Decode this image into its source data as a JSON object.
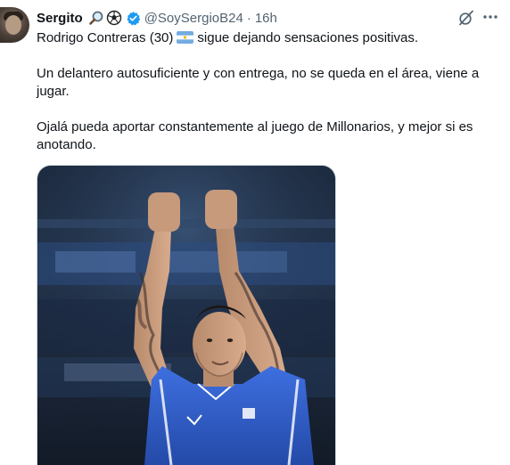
{
  "author": {
    "name": "Sergito",
    "handle": "@SoySergioB24",
    "separator": "·",
    "time": "16h",
    "name_emojis": [
      "magnifying-glass-icon",
      "soccer-ball-icon"
    ],
    "verified": true
  },
  "tweet": {
    "p1_before": "Rodrigo Contreras (30)",
    "p1_flag": "argentina-flag-icon",
    "p1_after": "sigue dejando sensaciones positivas.",
    "p2": "Un delantero autosuficiente y con entrega, no se queda en el área, viene a jugar.",
    "p3": "Ojalá pueda aportar constantemente al juego de Millonarios, y mejor si es anotando."
  },
  "actions": {
    "grok_icon": "grok-icon",
    "more_icon": "more-icon"
  },
  "colors": {
    "text": "#0f1419",
    "secondary": "#536471",
    "verified": "#1d9bf0",
    "jersey": "#2f5fd0"
  }
}
